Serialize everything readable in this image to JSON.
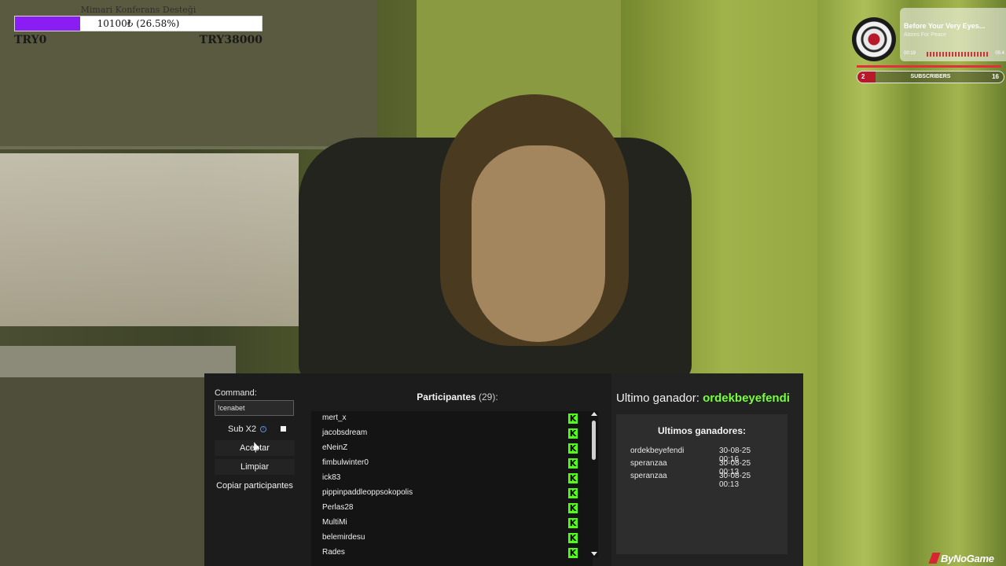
{
  "goal": {
    "title": "Mimari Konferans Desteği",
    "bar_text": "10100₺ (26.58%)",
    "progress_percent": 26.58,
    "min_label": "TRY0",
    "max_label": "TRY38000",
    "fill_color": "#8a1cf4"
  },
  "now_playing": {
    "title": "Before Your Very Eyes...",
    "artist": "Atoms For Peace",
    "time_elapsed": "00:19",
    "time_total": "05:4",
    "accent_color": "#e0303a"
  },
  "subscribers": {
    "current": "2",
    "label": "SUBSCRIBERS",
    "goal": "16",
    "progress_fraction": 0.125,
    "color": "#b8182a"
  },
  "giveaway": {
    "command_label": "Command:",
    "command_value": "!cenabet",
    "sub_x2_label": "Sub X2",
    "info_icon_glyph": "i",
    "accept_label": "Aceptar",
    "clear_label": "Limpiar",
    "copy_label": "Copiar participantes",
    "participants_title": "Participantes",
    "participants_count": "(29):",
    "participants": [
      {
        "name": "mert_x",
        "platform_icon": "kick-icon"
      },
      {
        "name": "jacobsdream",
        "platform_icon": "kick-icon"
      },
      {
        "name": "eNeinZ",
        "platform_icon": "kick-icon"
      },
      {
        "name": "fimbulwinter0",
        "platform_icon": "kick-icon"
      },
      {
        "name": "ick83",
        "platform_icon": "kick-icon"
      },
      {
        "name": "pippinpaddleoppsokopolis",
        "platform_icon": "kick-icon"
      },
      {
        "name": "Perlas28",
        "platform_icon": "kick-icon"
      },
      {
        "name": "MultiMi",
        "platform_icon": "kick-icon"
      },
      {
        "name": "belemirdesu",
        "platform_icon": "kick-icon"
      },
      {
        "name": "Rades",
        "platform_icon": "kick-icon"
      }
    ],
    "kick_glyph": "K",
    "kick_color": "#53fc18",
    "last_winner_label": "Ultimo ganador:",
    "last_winner_name": "ordekbeyefendi",
    "last_winners_title": "Ultimos ganadores:",
    "last_winners": [
      {
        "name": "ordekbeyefendi",
        "time": "30-08-25 00:16"
      },
      {
        "name": "speranzaa",
        "time": "30-08-25 00:13"
      },
      {
        "name": "speranzaa",
        "time": "30-08-25 00:13"
      }
    ]
  },
  "brand": {
    "text": "ByNoGame",
    "icon": "bynogame-logo-icon"
  }
}
